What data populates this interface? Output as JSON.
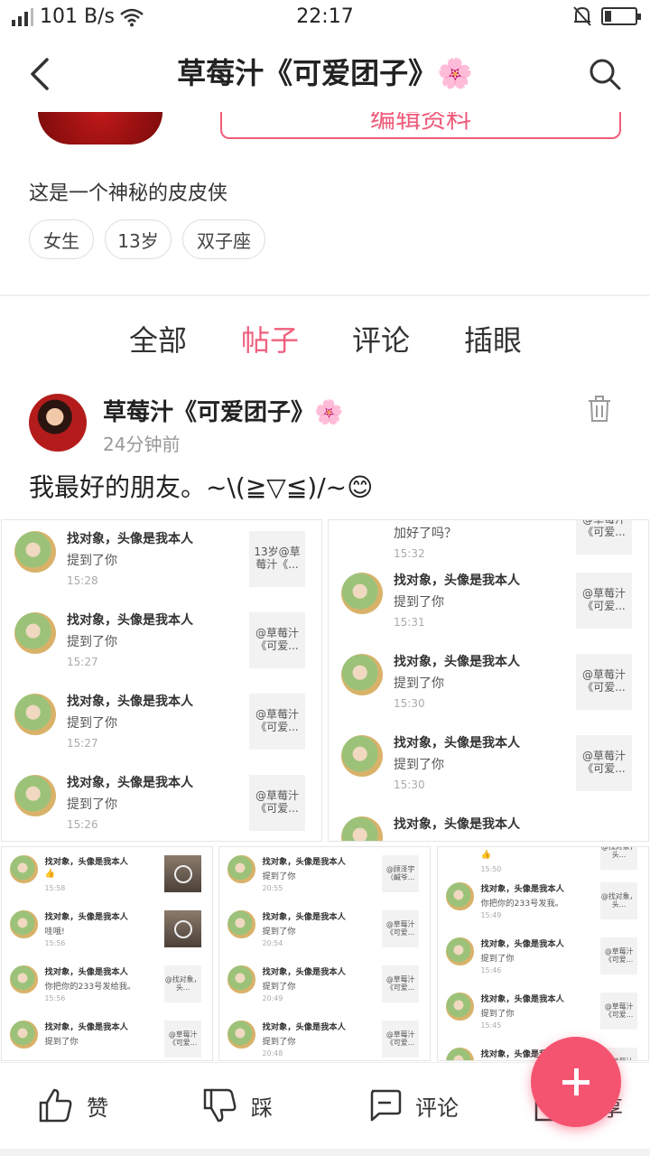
{
  "status_bar": {
    "net_speed": "101 B/s",
    "time": "22:17",
    "signal_icon": "signal-icon",
    "wifi_icon": "wifi-icon",
    "mute_icon": "mute-bell-icon",
    "battery_level": 0.2
  },
  "header": {
    "title": "草莓汁《可爱团子》🌸"
  },
  "profile": {
    "edit_button_label": "编辑资料",
    "bio": "这是一个神秘的皮皮侠",
    "tags": [
      "女生",
      "13岁",
      "双子座"
    ]
  },
  "tabs": [
    {
      "label": "全部",
      "active": false
    },
    {
      "label": "帖子",
      "active": true
    },
    {
      "label": "评论",
      "active": false
    },
    {
      "label": "插眼",
      "active": false
    }
  ],
  "post": {
    "author": "草莓汁《可爱团子》🌸",
    "time": "24分钟前",
    "text": "我最好的朋友。~\\(≧▽≦)/~😊"
  },
  "screenshots": [
    {
      "items": [
        {
          "title": "找对象，头像是我本人",
          "sub": "提到了你",
          "time": "15:28",
          "thumb": "13岁@草莓汁《..."
        },
        {
          "title": "找对象，头像是我本人",
          "sub": "提到了你",
          "time": "15:27",
          "thumb": "@草莓汁《可爱..."
        },
        {
          "title": "找对象，头像是我本人",
          "sub": "提到了你",
          "time": "15:27",
          "thumb": "@草莓汁《可爱..."
        },
        {
          "title": "找对象，头像是我本人",
          "sub": "提到了你",
          "time": "15:26",
          "thumb": "@草莓汁《可爱..."
        }
      ]
    },
    {
      "top_partial": {
        "sub": "加好了吗？",
        "time": "15:32",
        "thumb": "@草莓汁《可爱..."
      },
      "items": [
        {
          "title": "找对象，头像是我本人",
          "sub": "提到了你",
          "time": "15:31",
          "thumb": "@草莓汁《可爱..."
        },
        {
          "title": "找对象，头像是我本人",
          "sub": "提到了你",
          "time": "15:30",
          "thumb": "@草莓汁《可爱..."
        },
        {
          "title": "找对象，头像是我本人",
          "sub": "提到了你",
          "time": "15:30",
          "thumb": "@草莓汁《可爱..."
        },
        {
          "title": "找对象，头像是我本人",
          "sub": "",
          "time": "",
          "thumb": ""
        }
      ]
    },
    {
      "items": [
        {
          "title": "找对象，头像是我本人",
          "sub": "👍",
          "time": "15:58",
          "thumb": "",
          "video": true
        },
        {
          "title": "找对象，头像是我本人",
          "sub": "哇哦!",
          "time": "15:56",
          "thumb": "",
          "video": true
        },
        {
          "title": "找对象，头像是我本人",
          "sub": "你把你的233号发给我。",
          "time": "15:56",
          "thumb": "@找对象，头..."
        },
        {
          "title": "找对象，头像是我本人",
          "sub": "提到了你",
          "time": "",
          "thumb": "@草莓汁《可爱..."
        }
      ]
    },
    {
      "items": [
        {
          "title": "找对象，头像是我本人",
          "sub": "提到了你",
          "time": "20:55",
          "thumb": "@顾泽宇（鹹爷..."
        },
        {
          "title": "找对象，头像是我本人",
          "sub": "提到了你",
          "time": "20:54",
          "thumb": "@草莓汁《可爱..."
        },
        {
          "title": "找对象，头像是我本人",
          "sub": "提到了你",
          "time": "20:49",
          "thumb": "@草莓汁《可爱..."
        },
        {
          "title": "找对象，头像是我本人",
          "sub": "提到了你",
          "time": "20:48",
          "thumb": "@草莓汁《可爱..."
        }
      ]
    },
    {
      "top_partial": {
        "sub": "👍",
        "time": "15:50",
        "thumb": "@找对象，头..."
      },
      "items": [
        {
          "title": "找对象，头像是我本人",
          "sub": "你把你的233号发我。",
          "time": "15:49",
          "thumb": "@找对象，头..."
        },
        {
          "title": "找对象，头像是我本人",
          "sub": "提到了你",
          "time": "15:46",
          "thumb": "@草莓汁《可爱..."
        },
        {
          "title": "找对象，头像是我本人",
          "sub": "提到了你",
          "time": "15:45",
          "thumb": "@草莓汁《可爱..."
        },
        {
          "title": "找对象，头像是我本人",
          "sub": "",
          "time": "",
          "thumb": "@草莓汁《可爱..."
        }
      ]
    }
  ],
  "bottom_bar": {
    "like_label": "赞",
    "dislike_label": "踩",
    "comment_label": "评论",
    "share_label": "分享"
  },
  "colors": {
    "accent": "#f0607e",
    "fab": "#f55471"
  }
}
